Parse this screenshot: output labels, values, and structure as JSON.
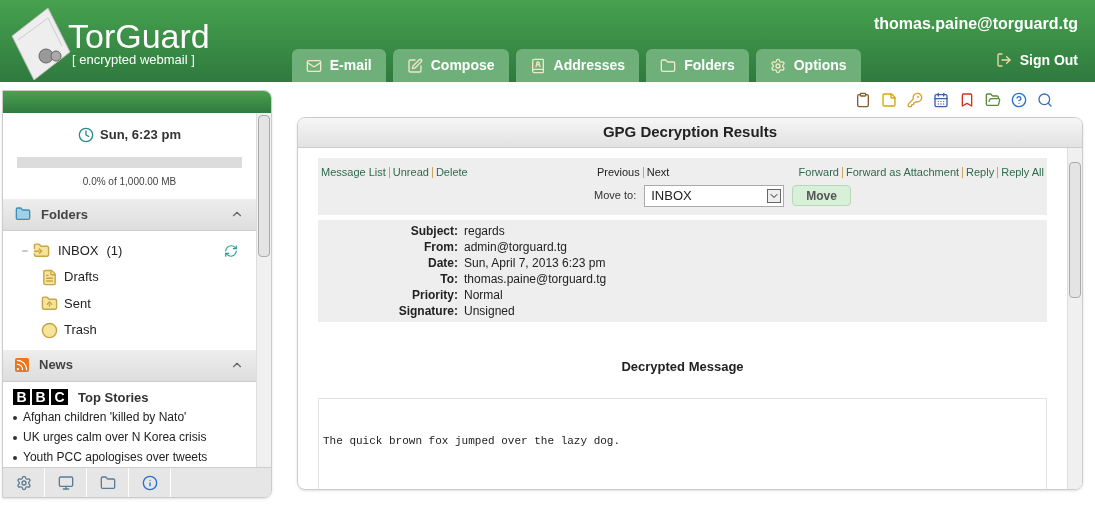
{
  "logo": {
    "name": "TorGuard",
    "tagline": "[ encrypted webmail ]"
  },
  "account": {
    "email": "thomas.paine@torguard.tg",
    "sign_out": "Sign Out"
  },
  "tabs": [
    {
      "label": "E-mail",
      "selected": false
    },
    {
      "label": "Compose",
      "selected": false
    },
    {
      "label": "Addresses",
      "selected": false
    },
    {
      "label": "Folders",
      "selected": false
    },
    {
      "label": "Options",
      "selected": false
    }
  ],
  "sidebar": {
    "clock": "Sun, 6:23 pm",
    "quota": {
      "level": 0,
      "reading": "0.0% of 1,000.00 MB"
    },
    "folders": {
      "title": "Folders",
      "items": [
        {
          "name": "INBOX",
          "count": "(1)",
          "kind": "inbox",
          "expanded": true,
          "children": [
            {
              "name": "Drafts",
              "kind": "drafts"
            },
            {
              "name": "Sent",
              "kind": "sent"
            },
            {
              "name": "Trash",
              "kind": "trash"
            }
          ]
        }
      ]
    },
    "news": {
      "title": "News",
      "source_letters": [
        "B",
        "B",
        "C"
      ],
      "heading": "Top Stories",
      "items": [
        "Afghan children 'killed by Nato'",
        "UK urges calm over N Korea crisis",
        "Youth PCC apologises over tweets"
      ]
    }
  },
  "panel": {
    "title": "GPG Decryption Results",
    "nav_left": [
      "Message List",
      "Unread",
      "Delete"
    ],
    "nav_center": [
      "Previous",
      "Next"
    ],
    "nav_right": [
      "Forward",
      "Forward as Attachment",
      "Reply",
      "Reply All"
    ],
    "move": {
      "label": "Move to:",
      "value": "INBOX",
      "button": "Move"
    },
    "headers": [
      {
        "label": "Subject:",
        "value": "regards"
      },
      {
        "label": "From:",
        "value": "admin@torguard.tg"
      },
      {
        "label": "Date:",
        "value": "Sun, April 7, 2013 6:23 pm"
      },
      {
        "label": "To:",
        "value": "thomas.paine@torguard.tg"
      },
      {
        "label": "Priority:",
        "value": "Normal"
      },
      {
        "label": "Signature:",
        "value": "Unsigned"
      }
    ],
    "section_title": "Decrypted Message",
    "body": "The quick brown fox jumped over the lazy dog."
  }
}
